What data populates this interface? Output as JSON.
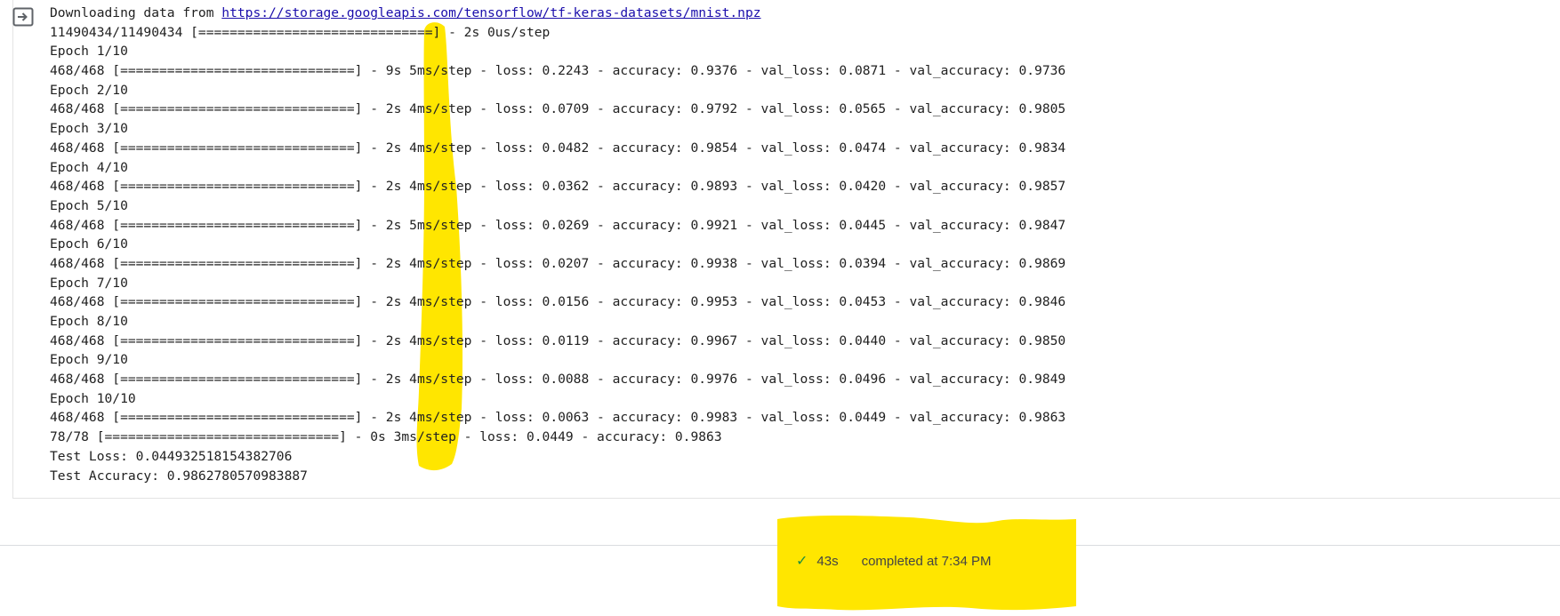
{
  "output": {
    "download_prefix": "Downloading data from ",
    "download_url": "https://storage.googleapis.com/tensorflow/tf-keras-datasets/mnist.npz",
    "lines": [
      "11490434/11490434 [==============================] - 2s 0us/step",
      "Epoch 1/10",
      "468/468 [==============================] - 9s 5ms/step - loss: 0.2243 - accuracy: 0.9376 - val_loss: 0.0871 - val_accuracy: 0.9736",
      "Epoch 2/10",
      "468/468 [==============================] - 2s 4ms/step - loss: 0.0709 - accuracy: 0.9792 - val_loss: 0.0565 - val_accuracy: 0.9805",
      "Epoch 3/10",
      "468/468 [==============================] - 2s 4ms/step - loss: 0.0482 - accuracy: 0.9854 - val_loss: 0.0474 - val_accuracy: 0.9834",
      "Epoch 4/10",
      "468/468 [==============================] - 2s 4ms/step - loss: 0.0362 - accuracy: 0.9893 - val_loss: 0.0420 - val_accuracy: 0.9857",
      "Epoch 5/10",
      "468/468 [==============================] - 2s 5ms/step - loss: 0.0269 - accuracy: 0.9921 - val_loss: 0.0445 - val_accuracy: 0.9847",
      "Epoch 6/10",
      "468/468 [==============================] - 2s 4ms/step - loss: 0.0207 - accuracy: 0.9938 - val_loss: 0.0394 - val_accuracy: 0.9869",
      "Epoch 7/10",
      "468/468 [==============================] - 2s 4ms/step - loss: 0.0156 - accuracy: 0.9953 - val_loss: 0.0453 - val_accuracy: 0.9846",
      "Epoch 8/10",
      "468/468 [==============================] - 2s 4ms/step - loss: 0.0119 - accuracy: 0.9967 - val_loss: 0.0440 - val_accuracy: 0.9850",
      "Epoch 9/10",
      "468/468 [==============================] - 2s 4ms/step - loss: 0.0088 - accuracy: 0.9976 - val_loss: 0.0496 - val_accuracy: 0.9849",
      "Epoch 10/10",
      "468/468 [==============================] - 2s 4ms/step - loss: 0.0063 - accuracy: 0.9983 - val_loss: 0.0449 - val_accuracy: 0.9863",
      "78/78 [==============================] - 0s 3ms/step - loss: 0.0449 - accuracy: 0.9863",
      "Test Loss: 0.044932518154382706",
      "Test Accuracy: 0.9862780570983887"
    ]
  },
  "status": {
    "icon": "check-icon",
    "duration": "43s",
    "completed": "completed at 7:34 PM"
  },
  "colors": {
    "highlight": "#ffe600",
    "link": "#1a0dab",
    "check": "#1e8e3e"
  }
}
